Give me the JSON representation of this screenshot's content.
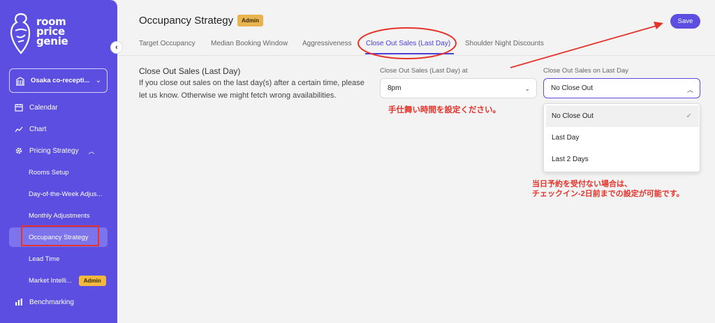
{
  "sidebar": {
    "brand": [
      "room",
      "price",
      "genie"
    ],
    "property_name": "Osaka co-recepti...",
    "nav": {
      "calendar": "Calendar",
      "chart": "Chart",
      "pricing_strategy": "Pricing Strategy",
      "rooms_setup": "Rooms Setup",
      "dow": "Day-of-the-Week Adjus...",
      "monthly": "Monthly Adjustments",
      "occupancy": "Occupancy Strategy",
      "lead_time": "Lead Time",
      "market": "Market Intelli...",
      "market_badge": "Admin",
      "benchmarking": "Benchmarking"
    }
  },
  "header": {
    "title": "Occupancy Strategy",
    "badge": "Admin",
    "save": "Save"
  },
  "tabs": [
    "Target Occupancy",
    "Median Booking Window",
    "Aggressiveness",
    "Close Out Sales (Last Day)",
    "Shoulder Night Discounts"
  ],
  "section": {
    "title": "Close Out Sales (Last Day)",
    "description": "If you close out sales on the last day(s) after a certain time, please let us know. Otherwise we might fetch wrong availabilities."
  },
  "fields": {
    "time_label": "Close Out Sales (Last Day) at",
    "time_value": "8pm",
    "days_label": "Close Out Sales on Last Day",
    "days_value": "No Close Out",
    "options": [
      "No Close Out",
      "Last Day",
      "Last 2 Days"
    ]
  },
  "annotations": {
    "time_note": "手仕舞い時間を設定ください。",
    "days_note_1": "当日予約を受付ない場合は、",
    "days_note_2": "チェックイン-2日前までの設定が可能です。"
  },
  "colors": {
    "brand": "#5b4ee0",
    "annotation": "#e5332a",
    "admin_badge": "#f1b83d"
  }
}
